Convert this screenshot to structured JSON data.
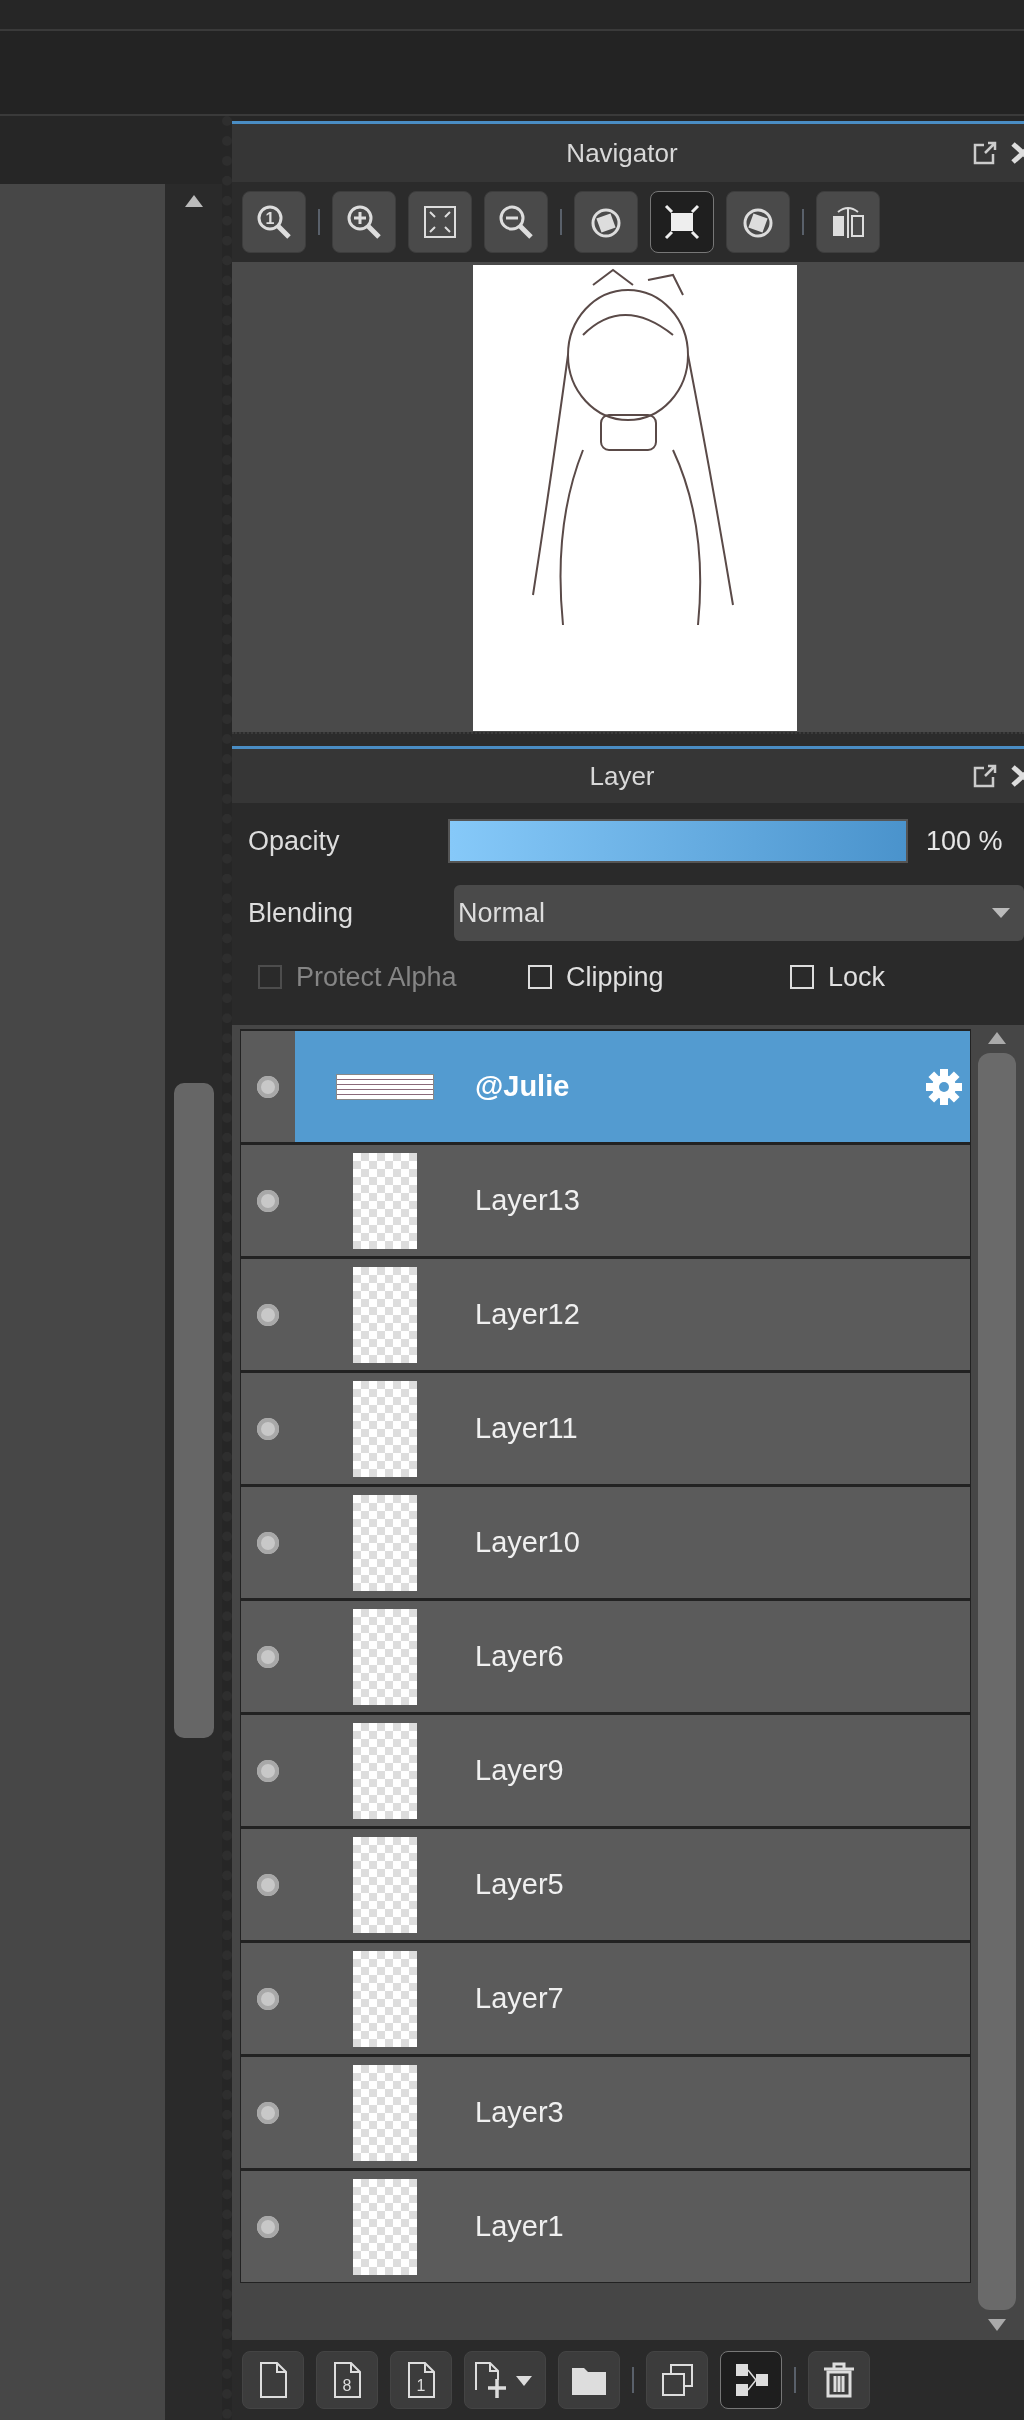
{
  "navigator": {
    "title": "Navigator",
    "tools": [
      {
        "kind": "zoom-actual",
        "label": "1",
        "selected": false,
        "separator_before": false
      },
      {
        "kind": "zoom-in",
        "selected": false,
        "separator_before": true
      },
      {
        "kind": "fit-frame",
        "selected": false,
        "separator_before": false
      },
      {
        "kind": "zoom-out",
        "selected": false,
        "separator_before": false
      },
      {
        "kind": "rotate-left",
        "selected": false,
        "separator_before": true
      },
      {
        "kind": "fit-window",
        "selected": true,
        "separator_before": false
      },
      {
        "kind": "rotate-right",
        "selected": false,
        "separator_before": false
      },
      {
        "kind": "flip",
        "selected": false,
        "separator_before": true
      }
    ]
  },
  "layer_panel": {
    "title": "Layer",
    "opacity": {
      "label": "Opacity",
      "level": 1.0,
      "reading": "100 %"
    },
    "blending": {
      "label": "Blending",
      "value": "Normal"
    },
    "options": [
      {
        "label": "Protect Alpha",
        "checked": false,
        "disabled": true
      },
      {
        "label": "Clipping",
        "checked": false,
        "disabled": false
      },
      {
        "label": "Lock",
        "checked": false,
        "disabled": false
      }
    ],
    "layers": [
      {
        "name": "@Julie",
        "kind": "text",
        "selected": true
      },
      {
        "name": "Layer13",
        "kind": "raster",
        "selected": false
      },
      {
        "name": "Layer12",
        "kind": "raster",
        "selected": false
      },
      {
        "name": "Layer11",
        "kind": "raster",
        "selected": false
      },
      {
        "name": "Layer10",
        "kind": "raster",
        "selected": false
      },
      {
        "name": "Layer6",
        "kind": "raster",
        "selected": false
      },
      {
        "name": "Layer9",
        "kind": "raster",
        "selected": false
      },
      {
        "name": "Layer5",
        "kind": "raster",
        "selected": false
      },
      {
        "name": "Layer7",
        "kind": "raster",
        "selected": false
      },
      {
        "name": "Layer3",
        "kind": "raster",
        "selected": false
      },
      {
        "name": "Layer1",
        "kind": "raster",
        "selected": false
      }
    ],
    "tools": [
      {
        "kind": "new-layer",
        "selected": false,
        "separator_before": false
      },
      {
        "kind": "new-layer-8bit",
        "label": "8",
        "selected": false,
        "separator_before": false
      },
      {
        "kind": "new-layer-1bit",
        "label": "1",
        "selected": false,
        "separator_before": false
      },
      {
        "kind": "add-menu",
        "selected": false,
        "separator_before": false
      },
      {
        "kind": "folder",
        "selected": false,
        "separator_before": false
      },
      {
        "kind": "duplicate",
        "selected": false,
        "separator_before": true
      },
      {
        "kind": "merge",
        "selected": true,
        "separator_before": false
      },
      {
        "kind": "delete",
        "selected": false,
        "separator_before": true
      }
    ]
  }
}
